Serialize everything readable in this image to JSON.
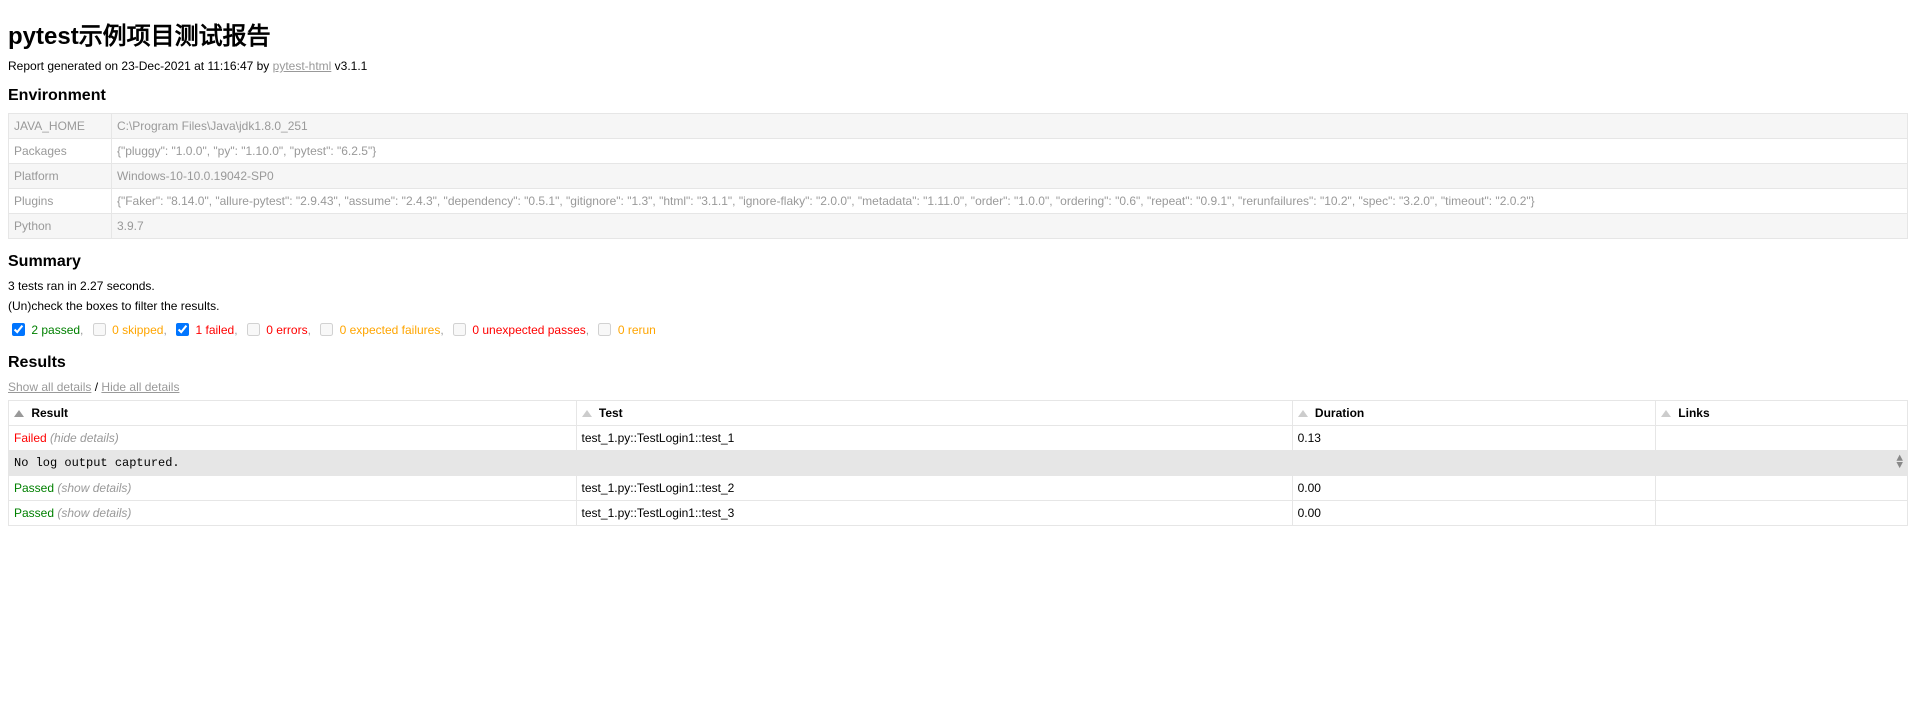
{
  "title": "pytest示例项目测试报告",
  "report_generated_prefix": "Report generated on 23-Dec-2021 at 11:16:47 by ",
  "report_link_text": "pytest-html",
  "report_version_suffix": " v3.1.1",
  "env_heading": "Environment",
  "environment": [
    {
      "key": "JAVA_HOME",
      "value": "C:\\Program Files\\Java\\jdk1.8.0_251"
    },
    {
      "key": "Packages",
      "value": "{\"pluggy\": \"1.0.0\", \"py\": \"1.10.0\", \"pytest\": \"6.2.5\"}"
    },
    {
      "key": "Platform",
      "value": "Windows-10-10.0.19042-SP0"
    },
    {
      "key": "Plugins",
      "value": "{\"Faker\": \"8.14.0\", \"allure-pytest\": \"2.9.43\", \"assume\": \"2.4.3\", \"dependency\": \"0.5.1\", \"gitignore\": \"1.3\", \"html\": \"3.1.1\", \"ignore-flaky\": \"2.0.0\", \"metadata\": \"1.11.0\", \"order\": \"1.0.0\", \"ordering\": \"0.6\", \"repeat\": \"0.9.1\", \"rerunfailures\": \"10.2\", \"spec\": \"3.2.0\", \"timeout\": \"2.0.2\"}"
    },
    {
      "key": "Python",
      "value": "3.9.7"
    }
  ],
  "summary_heading": "Summary",
  "summary_line": "3 tests ran in 2.27 seconds.",
  "filter_hint": "(Un)check the boxes to filter the results.",
  "filters": {
    "passed": {
      "label": "2 passed",
      "checked": true,
      "enabled": true,
      "class": "passed"
    },
    "skipped": {
      "label": "0 skipped",
      "checked": false,
      "enabled": false,
      "class": "skipped"
    },
    "failed": {
      "label": "1 failed",
      "checked": true,
      "enabled": true,
      "class": "failed"
    },
    "errors": {
      "label": "0 errors",
      "checked": false,
      "enabled": false,
      "class": "error"
    },
    "xfail": {
      "label": "0 expected failures",
      "checked": false,
      "enabled": false,
      "class": "xfail"
    },
    "xpass": {
      "label": "0 unexpected passes",
      "checked": false,
      "enabled": false,
      "class": "xpass"
    },
    "rerun": {
      "label": "0 rerun",
      "checked": false,
      "enabled": false,
      "class": "rerun"
    }
  },
  "results_heading": "Results",
  "show_all": "Show all details",
  "slash": " / ",
  "hide_all": "Hide all details",
  "columns": {
    "result": "Result",
    "test": "Test",
    "duration": "Duration",
    "links": "Links"
  },
  "rows": [
    {
      "status": "Failed",
      "status_class": "failed",
      "details_label": "(hide details)",
      "test": "test_1.py::TestLogin1::test_1",
      "duration": "0.13",
      "links": "",
      "log": "No log output captured."
    },
    {
      "status": "Passed",
      "status_class": "passed",
      "details_label": "(show details)",
      "test": "test_1.py::TestLogin1::test_2",
      "duration": "0.00",
      "links": ""
    },
    {
      "status": "Passed",
      "status_class": "passed",
      "details_label": "(show details)",
      "test": "test_1.py::TestLogin1::test_3",
      "duration": "0.00",
      "links": ""
    }
  ]
}
